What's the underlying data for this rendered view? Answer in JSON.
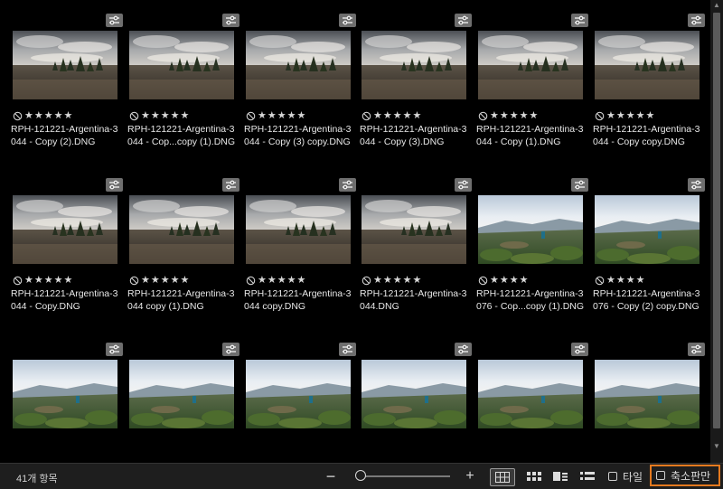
{
  "colors": {
    "accent_highlight": "#e57a1f",
    "background": "#000000",
    "toolbar": "#1e1e1e"
  },
  "thumbnails": [
    {
      "line1": "RPH-121221-Argentina-3",
      "line2": "044 - Copy (2).DNG",
      "stars": 5,
      "scene": "cloudy"
    },
    {
      "line1": "RPH-121221-Argentina-3",
      "line2": "044 - Cop...copy (1).DNG",
      "stars": 5,
      "scene": "cloudy"
    },
    {
      "line1": "RPH-121221-Argentina-3",
      "line2": "044 - Copy (3) copy.DNG",
      "stars": 5,
      "scene": "cloudy"
    },
    {
      "line1": "RPH-121221-Argentina-3",
      "line2": "044 - Copy (3).DNG",
      "stars": 5,
      "scene": "cloudy"
    },
    {
      "line1": "RPH-121221-Argentina-3",
      "line2": "044 - Copy (1).DNG",
      "stars": 5,
      "scene": "cloudy"
    },
    {
      "line1": "RPH-121221-Argentina-3",
      "line2": "044 - Copy copy.DNG",
      "stars": 5,
      "scene": "cloudy"
    },
    {
      "line1": "RPH-121221-Argentina-3",
      "line2": "044 - Copy.DNG",
      "stars": 5,
      "scene": "cloudy"
    },
    {
      "line1": "RPH-121221-Argentina-3",
      "line2": "044 copy (1).DNG",
      "stars": 5,
      "scene": "cloudy"
    },
    {
      "line1": "RPH-121221-Argentina-3",
      "line2": "044 copy.DNG",
      "stars": 5,
      "scene": "cloudy"
    },
    {
      "line1": "RPH-121221-Argentina-3",
      "line2": "044.DNG",
      "stars": 5,
      "scene": "cloudy"
    },
    {
      "line1": "RPH-121221-Argentina-3",
      "line2": "076 - Cop...copy (1).DNG",
      "stars": 4,
      "scene": "valley"
    },
    {
      "line1": "RPH-121221-Argentina-3",
      "line2": "076 - Copy (2) copy.DNG",
      "stars": 4,
      "scene": "valley"
    },
    {
      "line1": "",
      "line2": "",
      "stars": 0,
      "scene": "valley"
    },
    {
      "line1": "",
      "line2": "",
      "stars": 0,
      "scene": "valley"
    },
    {
      "line1": "",
      "line2": "",
      "stars": 0,
      "scene": "valley"
    },
    {
      "line1": "",
      "line2": "",
      "stars": 0,
      "scene": "valley"
    },
    {
      "line1": "",
      "line2": "",
      "stars": 0,
      "scene": "valley"
    },
    {
      "line1": "",
      "line2": "",
      "stars": 0,
      "scene": "valley"
    }
  ],
  "toolbar": {
    "item_count": "41개 항목",
    "zoom_out_label": "−",
    "zoom_in_label": "+",
    "zoom_level": 0.05,
    "view_buttons": [
      {
        "name": "grid-large-view",
        "icon": "grid-large-icon",
        "active": true
      },
      {
        "name": "grid-small-view",
        "icon": "grid-small-icon",
        "active": false
      },
      {
        "name": "filmstrip-detail-view",
        "icon": "detail-view-icon",
        "active": false
      },
      {
        "name": "list-view",
        "icon": "list-view-icon",
        "active": false
      }
    ],
    "tile_option": {
      "label": "타일",
      "checked": false
    },
    "filmstrip_only_option": {
      "label": "축소판만",
      "checked": false,
      "highlighted": true
    }
  }
}
